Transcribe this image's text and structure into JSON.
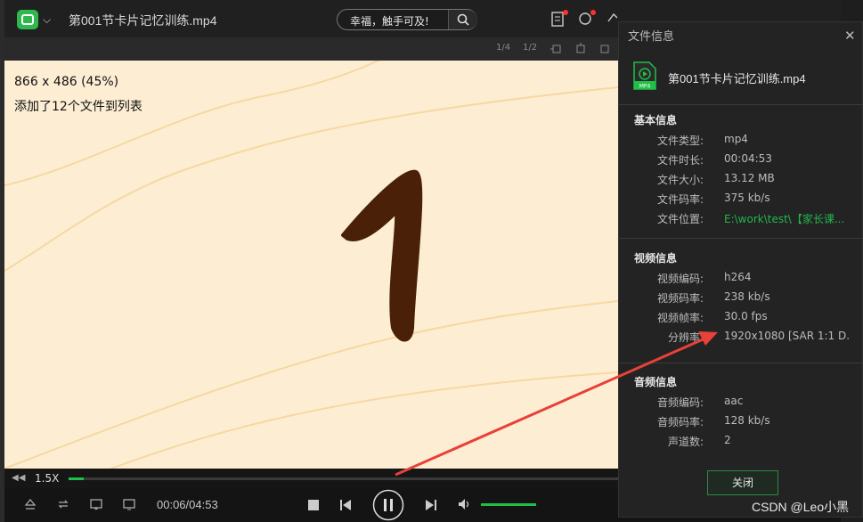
{
  "app": {
    "title": "第001节卡片记忆训练.mp4",
    "search_text": "幸福，触手可及!"
  },
  "subtoolbar": {
    "items": [
      "1/4",
      "1/2"
    ]
  },
  "osd": {
    "resolution": "866 x 486 (45%)",
    "message": "添加了12个文件到列表"
  },
  "video": {
    "digit": "1"
  },
  "controls": {
    "speed": "1.5X",
    "time": "00:06/04:53",
    "progress": 0.028,
    "volume": 1.0
  },
  "panel": {
    "title": "文件信息",
    "file_name": "第001节卡片记忆训练.mp4",
    "file_icon_badge": "MP4",
    "basic": {
      "title": "基本信息",
      "rows": [
        {
          "label": "文件类型:",
          "value": "mp4"
        },
        {
          "label": "文件时长:",
          "value": "00:04:53"
        },
        {
          "label": "文件大小:",
          "value": "13.12 MB"
        },
        {
          "label": "文件码率:",
          "value": "375 kb/s"
        },
        {
          "label": "文件位置:",
          "value": "E:\\work\\test\\【家长课..."
        }
      ]
    },
    "video": {
      "title": "视频信息",
      "rows": [
        {
          "label": "视频编码:",
          "value": "h264"
        },
        {
          "label": "视频码率:",
          "value": "238 kb/s"
        },
        {
          "label": "视频帧率:",
          "value": "30.0 fps"
        },
        {
          "label": "分辨率:",
          "value": "1920x1080 [SAR 1:1 D..."
        }
      ]
    },
    "audio": {
      "title": "音频信息",
      "rows": [
        {
          "label": "音频编码:",
          "value": "aac"
        },
        {
          "label": "音频码率:",
          "value": "128 kb/s"
        },
        {
          "label": "声道数:",
          "value": "2"
        }
      ]
    },
    "close_label": "关闭"
  },
  "watermark": "CSDN @Leo小黑",
  "colors": {
    "accent": "#20c048",
    "annotation": "#e8413a",
    "video_bg": "#fdeed3",
    "digit": "#4a2108"
  }
}
